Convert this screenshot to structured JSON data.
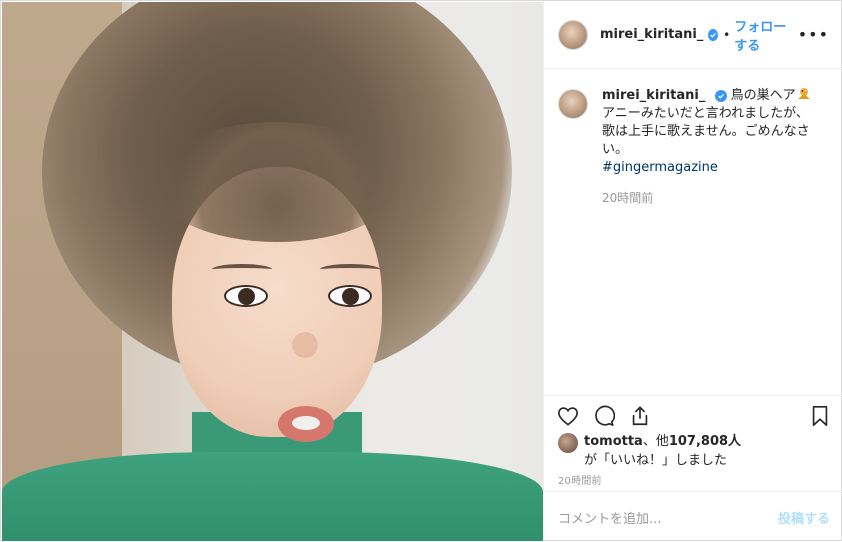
{
  "post": {
    "username": "mirei_kiritani_",
    "follow_label": "フォローする",
    "dot": "•",
    "more_label": "•••"
  },
  "caption": {
    "username": "mirei_kiritani_",
    "line1": "鳥の巣ヘア",
    "line2": "アニーみたいだと言われましたが、",
    "line3": "歌は上手に歌えません。ごめんなさい。",
    "hashtag": "#gingermagazine",
    "time": "20時間前"
  },
  "likes": {
    "liker": "tomotta",
    "text": "、他",
    "count": "107,808人",
    "suffix": "が「いいね！」しました"
  },
  "post_time": "20時間前",
  "add_comment": {
    "placeholder": "コメントを追加...",
    "post_label": "投稿する"
  },
  "colors": {
    "accent": "#3897f0",
    "hashtag": "#003569",
    "muted": "#999999",
    "post_disabled": "#b2dffc"
  },
  "icons": {
    "like": "heart-icon",
    "comment": "comment-bubble-icon",
    "share": "share-upload-icon",
    "save": "bookmark-icon",
    "verified": "verified-badge-icon",
    "hair_emoji": "bird-emoji-icon"
  }
}
